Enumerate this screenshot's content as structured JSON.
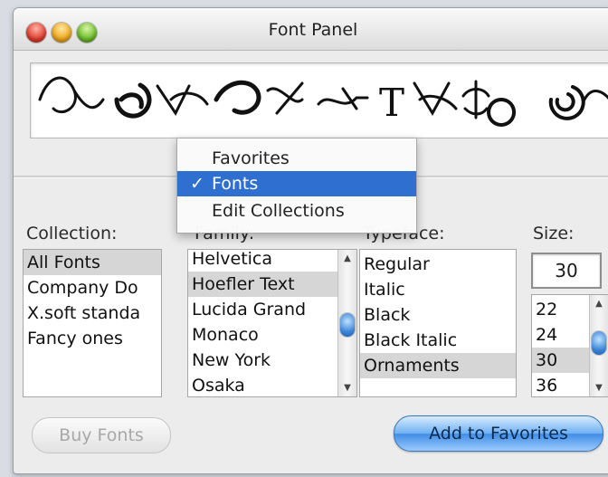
{
  "window": {
    "title": "Font Panel"
  },
  "collection": {
    "label": "Collection:",
    "items": [
      "All Fonts",
      "Company Do",
      "X.soft standa",
      "Fancy ones"
    ],
    "selected": 0
  },
  "family": {
    "label": "Family:",
    "items": [
      "Helvetica",
      "Hoefler Text",
      "Lucida Grand",
      "Monaco",
      "New York",
      "Osaka"
    ],
    "selected": 1
  },
  "typeface": {
    "label": "Typeface:",
    "items": [
      "Regular",
      "Italic",
      "Black",
      "Black Italic",
      "Ornaments"
    ],
    "selected": 4
  },
  "size": {
    "label": "Size:",
    "value": "30",
    "items": [
      "22",
      "24",
      "30",
      "36"
    ],
    "selected": 2
  },
  "popup_menu": {
    "items": [
      {
        "label": "Favorites",
        "checked": false
      },
      {
        "label": "Fonts",
        "checked": true
      },
      {
        "label": "Edit Collections",
        "checked": false
      }
    ],
    "checkmark": "✓"
  },
  "buttons": {
    "buy_fonts": "Buy Fonts",
    "add_to_favorites": "Add to Favorites"
  },
  "preview": {
    "ornament_glyphs": "T"
  },
  "colors": {
    "menu_highlight": "#2f6fd0",
    "primary_button": "#6eb0f2",
    "selection_gray": "#d6d6d6"
  }
}
